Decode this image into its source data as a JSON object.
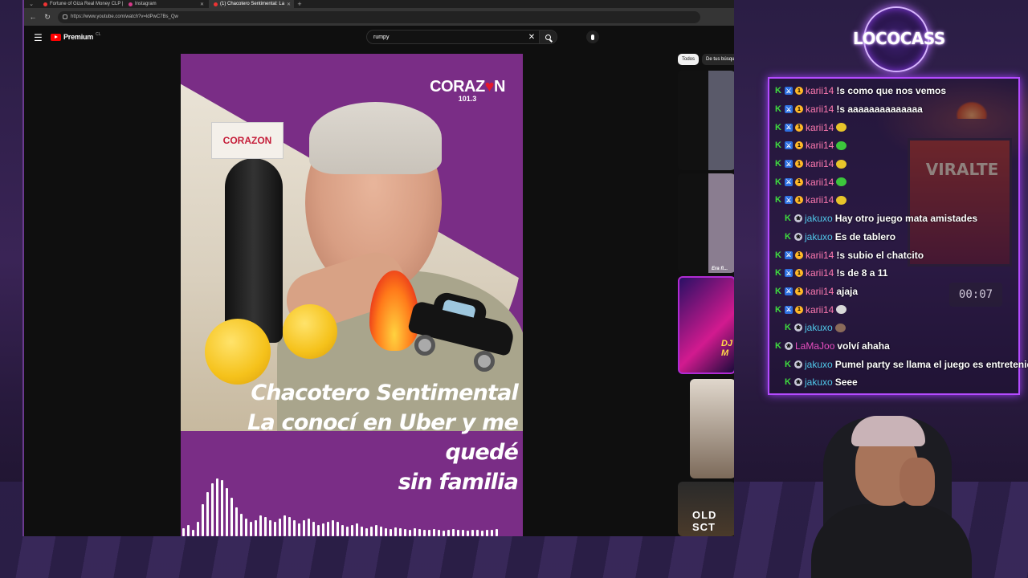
{
  "browser": {
    "tabs": [
      {
        "title": "Fortune of Giza Real Money CLP |",
        "active": false,
        "favicon": "red-circle"
      },
      {
        "title": "Instagram",
        "active": false,
        "favicon": "instagram-icon"
      },
      {
        "title": "(1) Chacotero Sentimental: La",
        "active": true,
        "favicon": "youtube-icon"
      }
    ],
    "new_tab": "+",
    "url": "https://www.youtube.com/watch?v=ldPwC7Bs_Qw"
  },
  "youtube": {
    "brand": "Premium",
    "country": "CL",
    "search_value": "rumpy",
    "chips": [
      "Todos",
      "De tus búsque"
    ]
  },
  "video": {
    "brand": "CORAZ",
    "brand_heart": "♥",
    "brand_end": "N",
    "frequency": "101.3",
    "mic_label": "CORAZON",
    "title_line1": "Chacotero Sentimental",
    "title_line2": "La conocí en Uber y me quedé",
    "title_line3": "sin familia"
  },
  "recommendations": [
    {
      "text": ""
    },
    {
      "text": "Era fi..."
    },
    {
      "text": "DJ M"
    },
    {
      "text": ""
    },
    {
      "text": "OLD SCT"
    }
  ],
  "overlay": {
    "logo": "LOCOCASS",
    "poster": "VIRALTE",
    "timer": "00:07",
    "colors": {
      "accent": "#b44bff",
      "chat_border": "#b44bff"
    }
  },
  "chat": [
    {
      "user": "karii14",
      "color": "#ff7ab0",
      "badges": [
        "k",
        "mod",
        "sub"
      ],
      "text": "!s como que nos vemos",
      "emote": ""
    },
    {
      "user": "karii14",
      "color": "#ff7ab0",
      "badges": [
        "k",
        "mod",
        "sub"
      ],
      "text": "!s aaaaaaaaaaaaaa",
      "emote": ""
    },
    {
      "user": "karii14",
      "color": "#ff7ab0",
      "badges": [
        "k",
        "mod",
        "sub"
      ],
      "text": "",
      "emote": "#e8c52a"
    },
    {
      "user": "karii14",
      "color": "#ff7ab0",
      "badges": [
        "k",
        "mod",
        "sub"
      ],
      "text": "",
      "emote": "#3cc63c"
    },
    {
      "user": "karii14",
      "color": "#ff7ab0",
      "badges": [
        "k",
        "mod",
        "sub"
      ],
      "text": "",
      "emote": "#e8c52a"
    },
    {
      "user": "karii14",
      "color": "#ff7ab0",
      "badges": [
        "k",
        "mod",
        "sub"
      ],
      "text": "",
      "emote": "#3cc63c"
    },
    {
      "user": "karii14",
      "color": "#ff7ab0",
      "badges": [
        "k",
        "mod",
        "sub"
      ],
      "text": "",
      "emote": "#e8c52a"
    },
    {
      "user": "jakuxo",
      "color": "#4fc6e8",
      "badges": [
        "k",
        "gift"
      ],
      "text": "Hay otro juego mata amistades",
      "emote": ""
    },
    {
      "user": "jakuxo",
      "color": "#4fc6e8",
      "badges": [
        "k",
        "gift"
      ],
      "text": "Es de tablero",
      "emote": ""
    },
    {
      "user": "karii14",
      "color": "#ff7ab0",
      "badges": [
        "k",
        "mod",
        "sub"
      ],
      "text": "!s subio el chatcito",
      "emote": ""
    },
    {
      "user": "karii14",
      "color": "#ff7ab0",
      "badges": [
        "k",
        "mod",
        "sub"
      ],
      "text": "!s de 8 a 11",
      "emote": ""
    },
    {
      "user": "karii14",
      "color": "#ff7ab0",
      "badges": [
        "k",
        "mod",
        "sub"
      ],
      "text": "ajaja",
      "emote": ""
    },
    {
      "user": "karii14",
      "color": "#ff7ab0",
      "badges": [
        "k",
        "mod",
        "sub"
      ],
      "text": "",
      "emote": "#d9d9d9"
    },
    {
      "user": "jakuxo",
      "color": "#4fc6e8",
      "badges": [
        "k",
        "gift"
      ],
      "text": "",
      "emote": "#8a6a5a"
    },
    {
      "user": "LaMaJoo",
      "color": "#e84fc0",
      "badges": [
        "k",
        "gift"
      ],
      "text": "volví ahaha",
      "emote": ""
    },
    {
      "user": "jakuxo",
      "color": "#4fc6e8",
      "badges": [
        "k",
        "gift"
      ],
      "text": "Pumel party se llama el juego es entretenido",
      "emote": ""
    },
    {
      "user": "jakuxo",
      "color": "#4fc6e8",
      "badges": [
        "k",
        "gift"
      ],
      "text": "Seee",
      "emote": ""
    }
  ],
  "chat_indent": [
    0,
    0,
    0,
    0,
    0,
    0,
    0,
    1,
    1,
    0,
    0,
    0,
    0,
    1,
    0,
    1,
    1
  ]
}
